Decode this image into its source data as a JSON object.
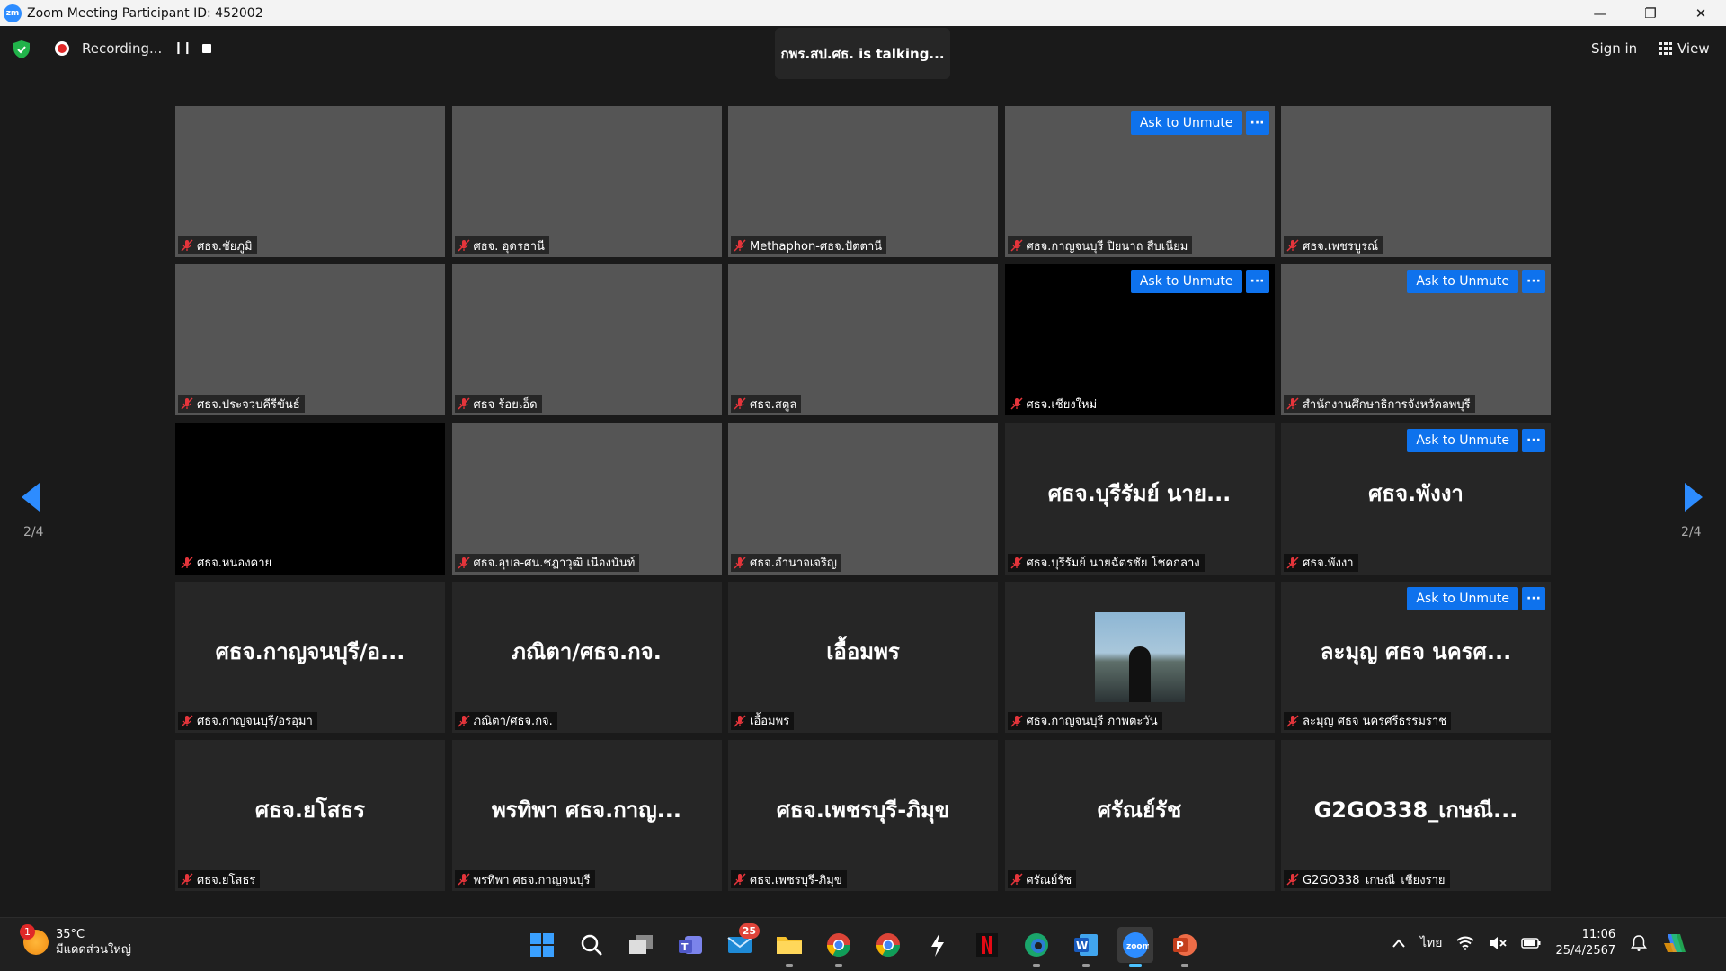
{
  "window": {
    "title": "Zoom Meeting Participant ID: 452002",
    "logo_text": "zm",
    "controls": [
      "—",
      "❐",
      "✕"
    ]
  },
  "topbar": {
    "recording_label": "Recording...",
    "pause_glyph": "❙❙",
    "talking_text": "กพร.สป.ศธ. is  talking...",
    "signin_label": "Sign in",
    "view_label": "View"
  },
  "pager": {
    "left_count": "2/4",
    "right_count": "2/4"
  },
  "ask_unmute_label": "Ask to Unmute",
  "more_label": "···",
  "tiles": [
    {
      "kind": "video",
      "bg": "v1",
      "name": "ศธจ.ชัยภูมิ",
      "ask": false
    },
    {
      "kind": "video",
      "bg": "v2",
      "name": "ศธจ. อุดรธานี",
      "ask": false
    },
    {
      "kind": "video",
      "bg": "v3",
      "name": "Methaphon-ศธจ.ปัตตานี",
      "ask": false
    },
    {
      "kind": "video",
      "bg": "v4",
      "name": "ศธจ.กาญจนบุรี ปิยนาถ สืบเนียม",
      "ask": true
    },
    {
      "kind": "video",
      "bg": "v5",
      "name": "ศธจ.เพชรบูรณ์",
      "ask": false
    },
    {
      "kind": "video",
      "bg": "v6",
      "name": "ศธจ.ประจวบคีรีขันธ์",
      "ask": false
    },
    {
      "kind": "video",
      "bg": "v7",
      "name": "ศธจ ร้อยเอ็ด",
      "ask": false
    },
    {
      "kind": "video",
      "bg": "v8",
      "name": "ศธจ.สตูล",
      "ask": false
    },
    {
      "kind": "black",
      "bg": "",
      "name": "ศธจ.เชียงใหม่",
      "ask": true
    },
    {
      "kind": "video",
      "bg": "v9",
      "name": "สำนักงานศึกษาธิการจังหวัดลพบุรี",
      "ask": true
    },
    {
      "kind": "black",
      "bg": "",
      "name": "ศธจ.หนองคาย",
      "ask": false
    },
    {
      "kind": "video",
      "bg": "v10",
      "name": "ศธจ.อุบล-ศน.ชฎาวุฒิ เนืองนันท์",
      "ask": false
    },
    {
      "kind": "video",
      "bg": "v11",
      "name": "ศธจ.อำนาจเจริญ",
      "ask": false
    },
    {
      "kind": "name",
      "bg": "",
      "display": "ศธจ.บุรีรัมย์ นาย...",
      "name": "ศธจ.บุรีรัมย์ นายฉัตรชัย โชคกลาง",
      "ask": false
    },
    {
      "kind": "name",
      "bg": "",
      "display": "ศธจ.พังงา",
      "name": "ศธจ.พังงา",
      "ask": true
    },
    {
      "kind": "name",
      "bg": "",
      "display": "ศธจ.กาญจนบุรี/อ...",
      "name": "ศธจ.กาญจนบุรี/อรอุมา",
      "ask": false
    },
    {
      "kind": "name",
      "bg": "",
      "display": "ภณิตา/ศธจ.กจ.",
      "name": "ภณิตา/ศธจ.กจ.",
      "ask": false
    },
    {
      "kind": "name",
      "bg": "",
      "display": "เอื้อมพร",
      "name": "เอื้อมพร",
      "ask": false
    },
    {
      "kind": "avatar",
      "bg": "",
      "name": "ศธจ.กาญจนบุรี ภาพตะวัน",
      "ask": false
    },
    {
      "kind": "name",
      "bg": "",
      "display": "ละมุญ ศธจ นครศ...",
      "name": "ละมุญ ศธจ นครศรีธรรมราช",
      "ask": true
    },
    {
      "kind": "name",
      "bg": "",
      "display": "ศธจ.ยโสธร",
      "name": "ศธจ.ยโสธร",
      "ask": false
    },
    {
      "kind": "name",
      "bg": "",
      "display": "พรทิพา ศธจ.กาญ...",
      "name": "พรทิพา ศธจ.กาญจนบุรี",
      "ask": false
    },
    {
      "kind": "name",
      "bg": "",
      "display": "ศธจ.เพชรบุรี-ภิมุข",
      "name": "ศธจ.เพชรบุรี-ภิมุข",
      "ask": false
    },
    {
      "kind": "name",
      "bg": "",
      "display": "ศรัณย์รัช",
      "name": "ศรัณย์รัช",
      "ask": false
    },
    {
      "kind": "name",
      "bg": "",
      "display": "G2GO338_เกษณี...",
      "name": "G2GO338_เกษณี_เชียงราย",
      "ask": false
    }
  ],
  "taskbar": {
    "weather_badge": "1",
    "temperature": "35°C",
    "weather_desc": "มีแดดส่วนใหญ่",
    "mail_badge": "25",
    "language": "ไทย",
    "time": "11:06",
    "date": "25/4/2567"
  },
  "colors": {
    "accent_blue": "#0e72ed",
    "recording_red": "#e02828",
    "muted_red": "#e5353b"
  }
}
